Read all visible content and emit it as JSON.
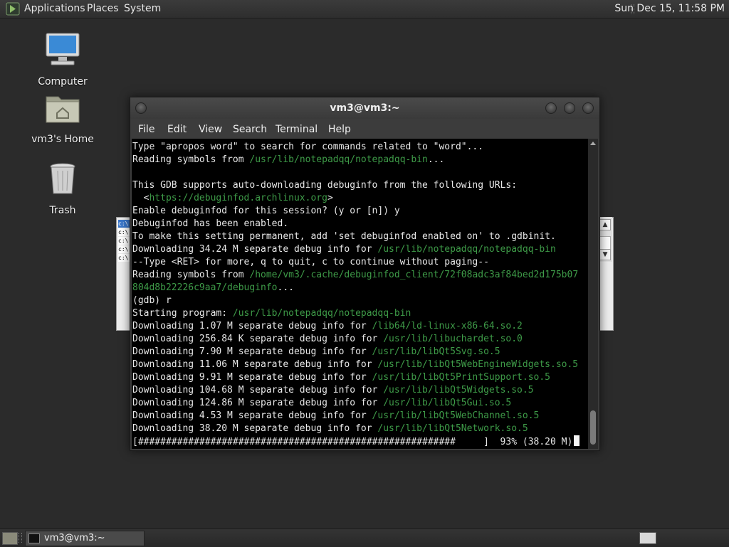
{
  "top_panel": {
    "menus": [
      "Applications",
      "Places",
      "System"
    ],
    "clock": "Sun Dec 15, 11:58 PM"
  },
  "desktop_icons": [
    {
      "label": "Computer",
      "icon": "computer-icon"
    },
    {
      "label": "vm3's Home",
      "icon": "home-folder-icon"
    },
    {
      "label": "Trash",
      "icon": "trash-icon"
    }
  ],
  "background_window": {
    "rows": [
      "c:\\",
      "c:\\",
      "c:\\",
      "c:\\",
      "c:\\"
    ]
  },
  "terminal": {
    "title": "vm3@vm3:~",
    "menu": [
      "File",
      "Edit",
      "View",
      "Search",
      "Terminal",
      "Help"
    ],
    "lines": [
      [
        {
          "t": "Type \"apropos word\" to search for commands related to \"word\"..."
        }
      ],
      [
        {
          "t": "Reading symbols from "
        },
        {
          "t": "/usr/lib/notepadqq/notepadqq-bin",
          "p": true
        },
        {
          "t": "..."
        }
      ],
      [
        {
          "t": ""
        }
      ],
      [
        {
          "t": "This GDB supports auto-downloading debuginfo from the following URLs:"
        }
      ],
      [
        {
          "t": "  <"
        },
        {
          "t": "https://debuginfod.archlinux.org",
          "p": true
        },
        {
          "t": ">"
        }
      ],
      [
        {
          "t": "Enable debuginfod for this session? (y or [n]) y"
        }
      ],
      [
        {
          "t": "Debuginfod has been enabled."
        }
      ],
      [
        {
          "t": "To make this setting permanent, add 'set debuginfod enabled on' to .gdbinit."
        }
      ],
      [
        {
          "t": "Downloading 34.24 M separate debug info for "
        },
        {
          "t": "/usr/lib/notepadqq/notepadqq-bin",
          "p": true
        }
      ],
      [
        {
          "t": "--Type <RET> for more, q to quit, c to continue without paging--"
        }
      ],
      [
        {
          "t": "Reading symbols from "
        },
        {
          "t": "/home/vm3/.cache/debuginfod_client/72f08adc3af84bed2d175b07",
          "p": true
        }
      ],
      [
        {
          "t": "804d8b22226c9aa7/debuginfo",
          "p": true
        },
        {
          "t": "..."
        }
      ],
      [
        {
          "t": "(gdb) r"
        }
      ],
      [
        {
          "t": "Starting program: "
        },
        {
          "t": "/usr/lib/notepadqq/notepadqq-bin",
          "p": true
        }
      ],
      [
        {
          "t": "Downloading 1.07 M separate debug info for "
        },
        {
          "t": "/lib64/ld-linux-x86-64.so.2",
          "p": true
        }
      ],
      [
        {
          "t": "Downloading 256.84 K separate debug info for "
        },
        {
          "t": "/usr/lib/libuchardet.so.0",
          "p": true
        }
      ],
      [
        {
          "t": "Downloading 7.90 M separate debug info for "
        },
        {
          "t": "/usr/lib/libQt5Svg.so.5",
          "p": true
        }
      ],
      [
        {
          "t": "Downloading 11.06 M separate debug info for "
        },
        {
          "t": "/usr/lib/libQt5WebEngineWidgets.so.5",
          "p": true
        }
      ],
      [
        {
          "t": "Downloading 9.91 M separate debug info for "
        },
        {
          "t": "/usr/lib/libQt5PrintSupport.so.5",
          "p": true
        }
      ],
      [
        {
          "t": "Downloading 104.68 M separate debug info for "
        },
        {
          "t": "/usr/lib/libQt5Widgets.so.5",
          "p": true
        }
      ],
      [
        {
          "t": "Downloading 124.86 M separate debug info for "
        },
        {
          "t": "/usr/lib/libQt5Gui.so.5",
          "p": true
        }
      ],
      [
        {
          "t": "Downloading 4.53 M separate debug info for "
        },
        {
          "t": "/usr/lib/libQt5WebChannel.so.5",
          "p": true
        }
      ],
      [
        {
          "t": "Downloading 38.20 M separate debug info for "
        },
        {
          "t": "/usr/lib/libQt5Network.so.5",
          "p": true
        }
      ],
      [
        {
          "t": "[#########################################################     ]  93% (38.20 M)"
        }
      ]
    ],
    "path_color": "#3e9b48"
  },
  "bottom_panel": {
    "task_label": "vm3@vm3:~"
  }
}
